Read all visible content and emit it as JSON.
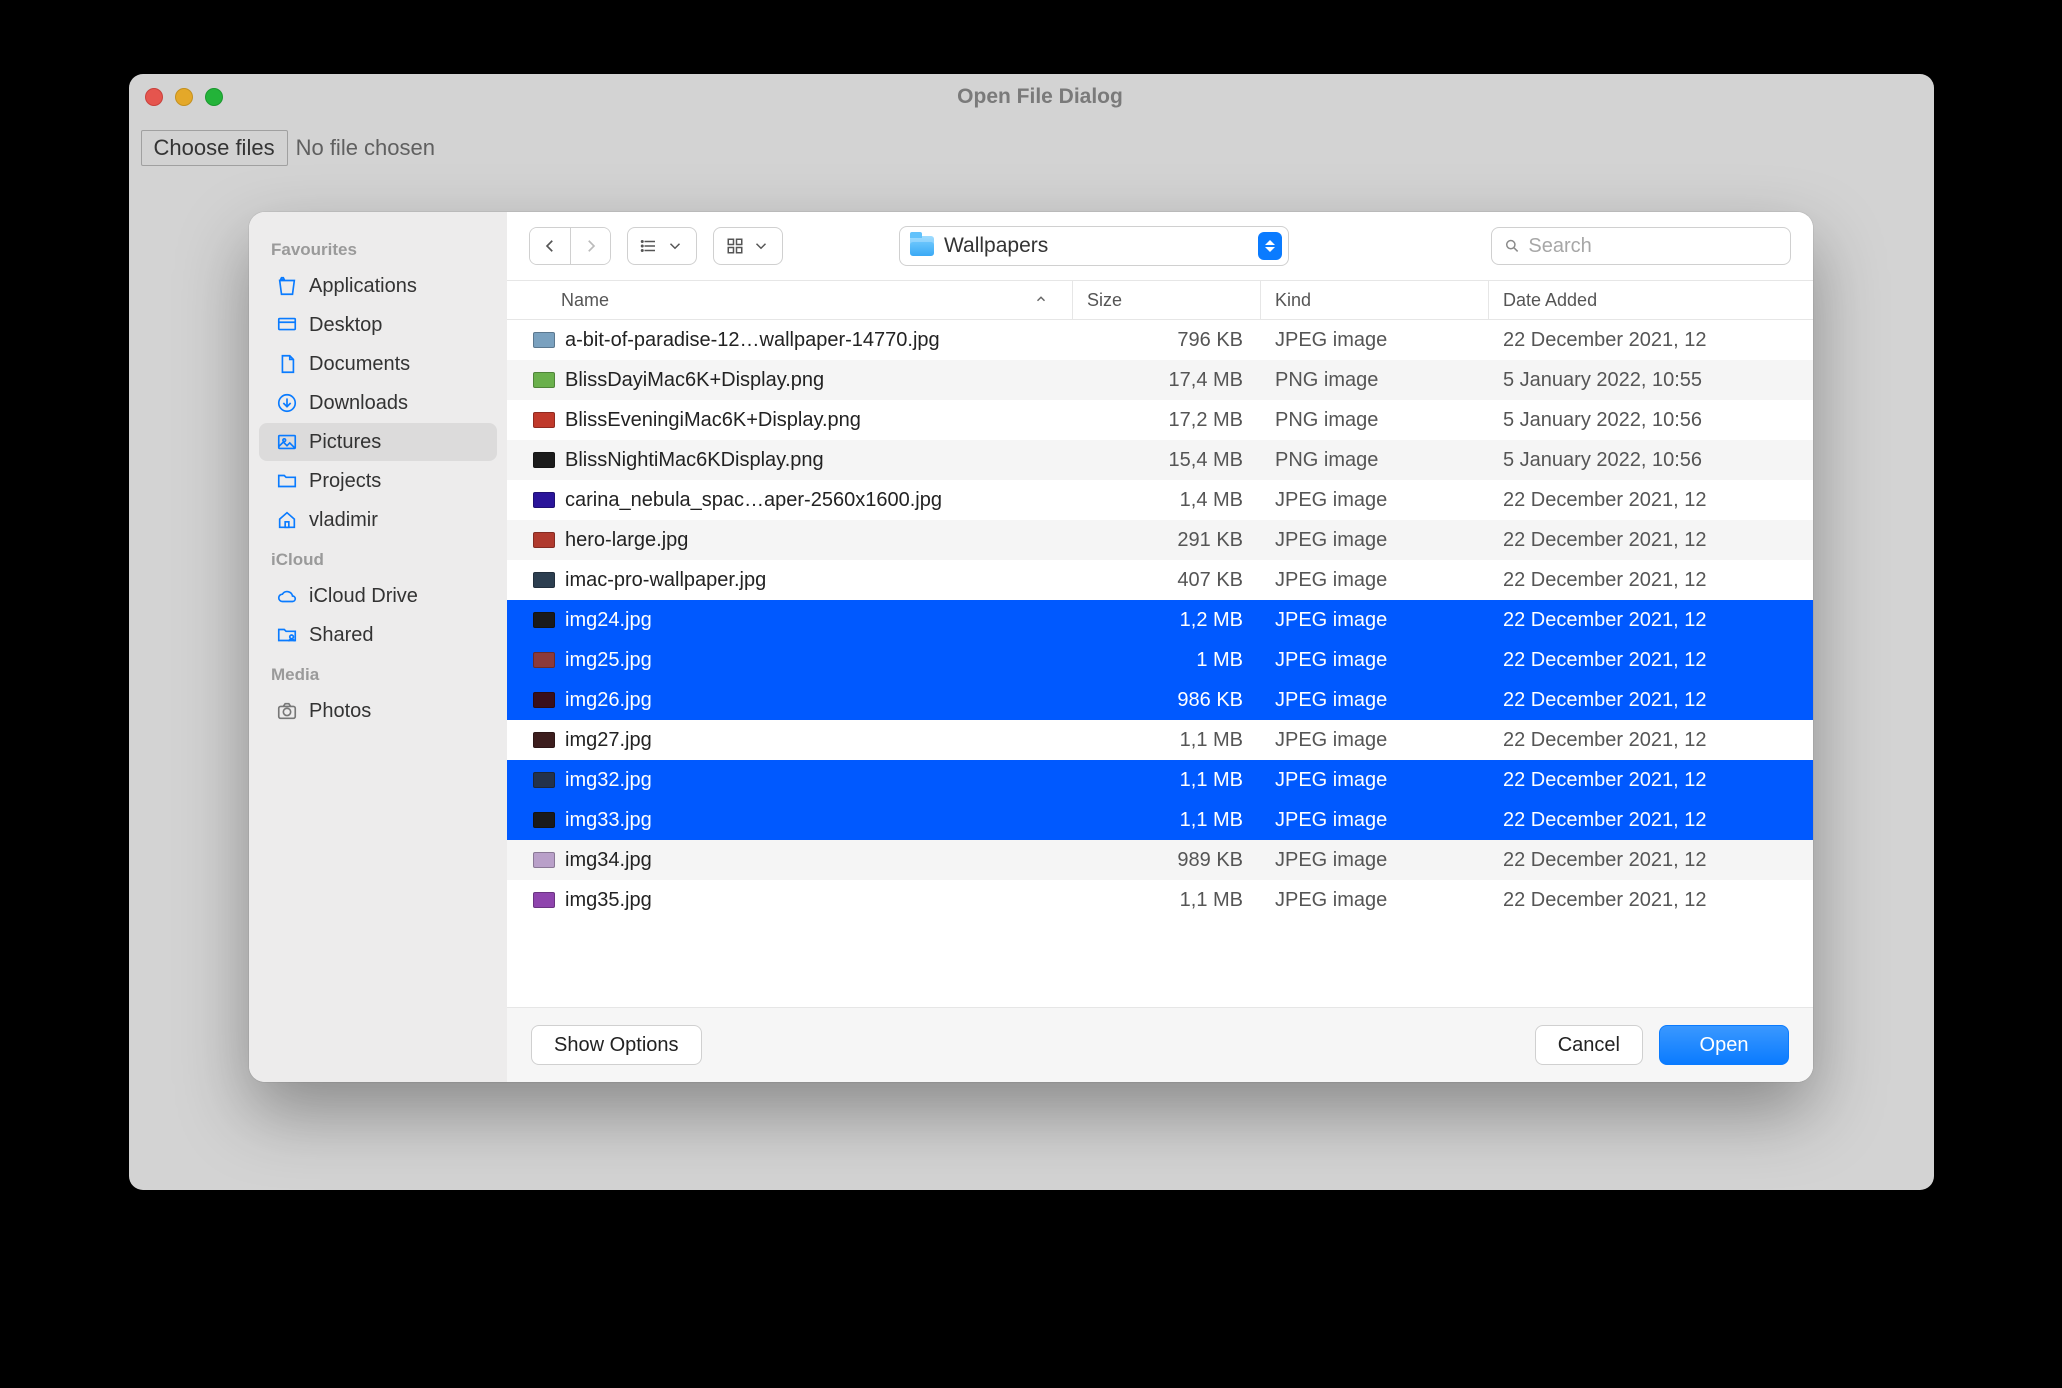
{
  "window": {
    "title": "Open File Dialog",
    "choose_files_label": "Choose files",
    "no_file_chosen": "No file chosen"
  },
  "sidebar": {
    "sections": [
      {
        "heading": "Favourites",
        "items": [
          {
            "icon": "apps-icon",
            "label": "Applications",
            "active": false
          },
          {
            "icon": "desktop-icon",
            "label": "Desktop",
            "active": false
          },
          {
            "icon": "document-icon",
            "label": "Documents",
            "active": false
          },
          {
            "icon": "download-icon",
            "label": "Downloads",
            "active": false
          },
          {
            "icon": "pictures-icon",
            "label": "Pictures",
            "active": true
          },
          {
            "icon": "folder-icon",
            "label": "Projects",
            "active": false
          },
          {
            "icon": "home-icon",
            "label": "vladimir",
            "active": false
          }
        ]
      },
      {
        "heading": "iCloud",
        "items": [
          {
            "icon": "cloud-icon",
            "label": "iCloud Drive",
            "active": false
          },
          {
            "icon": "shared-icon",
            "label": "Shared",
            "active": false
          }
        ]
      },
      {
        "heading": "Media",
        "items": [
          {
            "icon": "camera-icon",
            "label": "Photos",
            "active": false
          }
        ]
      }
    ]
  },
  "toolbar": {
    "current_folder": "Wallpapers",
    "search_placeholder": "Search"
  },
  "columns": {
    "name": "Name",
    "size": "Size",
    "kind": "Kind",
    "date": "Date Added"
  },
  "files": [
    {
      "name": "a-bit-of-paradise-12…wallpaper-14770.jpg",
      "size": "796 KB",
      "kind": "JPEG image",
      "date": "22 December 2021, 12",
      "selected": false,
      "thumb": "#7aa1bf"
    },
    {
      "name": "BlissDayiMac6K+Display.png",
      "size": "17,4 MB",
      "kind": "PNG image",
      "date": "5 January 2022, 10:55",
      "selected": false,
      "thumb": "#6ab04c"
    },
    {
      "name": "BlissEveningiMac6K+Display.png",
      "size": "17,2 MB",
      "kind": "PNG image",
      "date": "5 January 2022, 10:56",
      "selected": false,
      "thumb": "#c0392b"
    },
    {
      "name": "BlissNightiMac6KDisplay.png",
      "size": "15,4 MB",
      "kind": "PNG image",
      "date": "5 January 2022, 10:56",
      "selected": false,
      "thumb": "#1b1b1b"
    },
    {
      "name": "carina_nebula_spac…aper-2560x1600.jpg",
      "size": "1,4 MB",
      "kind": "JPEG image",
      "date": "22 December 2021, 12",
      "selected": false,
      "thumb": "#2a149a"
    },
    {
      "name": "hero-large.jpg",
      "size": "291 KB",
      "kind": "JPEG image",
      "date": "22 December 2021, 12",
      "selected": false,
      "thumb": "#b03a2e"
    },
    {
      "name": "imac-pro-wallpaper.jpg",
      "size": "407 KB",
      "kind": "JPEG image",
      "date": "22 December 2021, 12",
      "selected": false,
      "thumb": "#2c3e50"
    },
    {
      "name": "img24.jpg",
      "size": "1,2 MB",
      "kind": "JPEG image",
      "date": "22 December 2021, 12",
      "selected": true,
      "thumb": "#1a1a1a"
    },
    {
      "name": "img25.jpg",
      "size": "1 MB",
      "kind": "JPEG image",
      "date": "22 December 2021, 12",
      "selected": true,
      "thumb": "#8c3a3a"
    },
    {
      "name": "img26.jpg",
      "size": "986 KB",
      "kind": "JPEG image",
      "date": "22 December 2021, 12",
      "selected": true,
      "thumb": "#3a0f1a"
    },
    {
      "name": "img27.jpg",
      "size": "1,1 MB",
      "kind": "JPEG image",
      "date": "22 December 2021, 12",
      "selected": false,
      "thumb": "#3d1e1e"
    },
    {
      "name": "img32.jpg",
      "size": "1,1 MB",
      "kind": "JPEG image",
      "date": "22 December 2021, 12",
      "selected": true,
      "thumb": "#24324a"
    },
    {
      "name": "img33.jpg",
      "size": "1,1 MB",
      "kind": "JPEG image",
      "date": "22 December 2021, 12",
      "selected": true,
      "thumb": "#1a1a1a"
    },
    {
      "name": "img34.jpg",
      "size": "989 KB",
      "kind": "JPEG image",
      "date": "22 December 2021, 12",
      "selected": false,
      "thumb": "#b9a0c9"
    },
    {
      "name": "img35.jpg",
      "size": "1,1 MB",
      "kind": "JPEG image",
      "date": "22 December 2021, 12",
      "selected": false,
      "thumb": "#8e44ad"
    }
  ],
  "footer": {
    "show_options": "Show Options",
    "cancel": "Cancel",
    "open": "Open"
  }
}
